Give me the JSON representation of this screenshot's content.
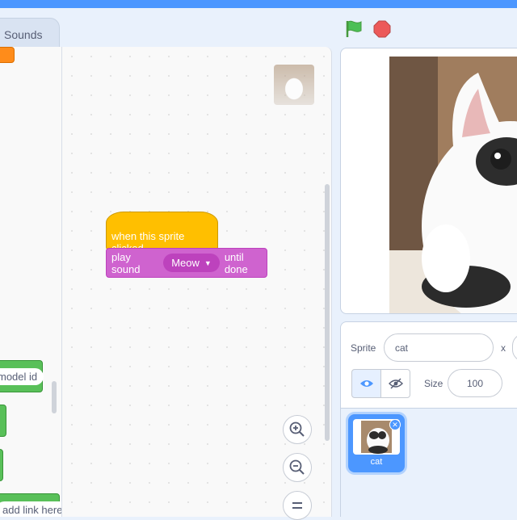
{
  "tabs": {
    "sounds": "Sounds"
  },
  "palette": {
    "model_id": "model id",
    "add_link": "add link here"
  },
  "script": {
    "hat_label": "when this sprite clicked",
    "stack_prefix": "play sound",
    "stack_sound": "Meow",
    "stack_suffix": "until done"
  },
  "zoom": {
    "in": "+",
    "out": "−",
    "reset": "="
  },
  "sprite_info": {
    "sprite_label": "Sprite",
    "sprite_name": "cat",
    "x_label": "x",
    "size_label": "Size",
    "size_value": "100"
  },
  "sprite_list": {
    "items": [
      {
        "name": "cat"
      }
    ]
  },
  "colors": {
    "accent": "#4c97ff",
    "events": "#ffbf00",
    "sound": "#cf63cf",
    "extension": "#59c059",
    "flag": "#4cbf56",
    "stop": "#ec5959"
  }
}
